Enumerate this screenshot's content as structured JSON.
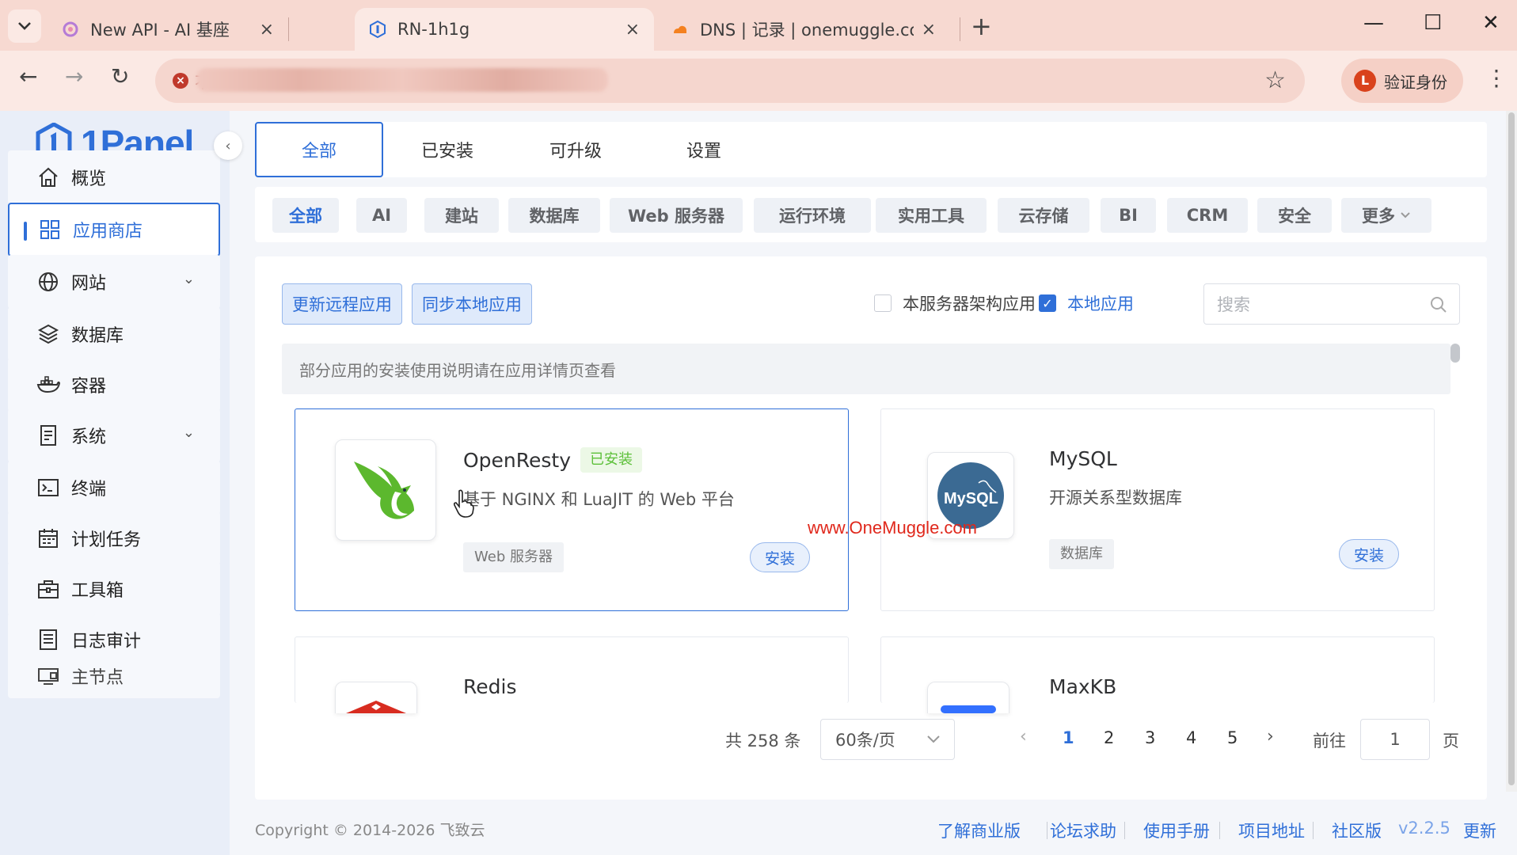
{
  "browser": {
    "tabs": [
      {
        "title": "New API - AI 基座",
        "close": "×"
      },
      {
        "title": "RN-1h1g",
        "close": "×"
      },
      {
        "title": "DNS | 记录 | onemuggle.com",
        "close": "×"
      }
    ],
    "new_tab": "+",
    "window": {
      "minimize": "—",
      "maximize": "☐",
      "close": "✕"
    },
    "nav": {
      "back": "←",
      "forward": "→",
      "reload": "↻"
    },
    "address_prefix": "不",
    "bookmark_star": "☆",
    "profile": {
      "initial": "L",
      "label": "验证身份"
    },
    "menu": "⋮"
  },
  "sidebar": {
    "logo": "1Panel",
    "collapse": "‹",
    "items": [
      {
        "label": "概览",
        "icon": "home-icon"
      },
      {
        "label": "应用商店",
        "icon": "grid-icon"
      },
      {
        "label": "网站",
        "icon": "globe-icon",
        "chevron": "⌄"
      },
      {
        "label": "数据库",
        "icon": "layers-icon"
      },
      {
        "label": "容器",
        "icon": "docker-icon"
      },
      {
        "label": "系统",
        "icon": "document-icon",
        "chevron": "⌄"
      },
      {
        "label": "终端",
        "icon": "terminal-icon"
      },
      {
        "label": "计划任务",
        "icon": "calendar-icon"
      },
      {
        "label": "工具箱",
        "icon": "toolbox-icon"
      },
      {
        "label": "日志审计",
        "icon": "log-icon"
      },
      {
        "label": "主节点",
        "icon": "node-icon"
      }
    ]
  },
  "topnav": {
    "tabs": [
      "全部",
      "已安装",
      "可升级",
      "设置"
    ]
  },
  "categories": [
    "全部",
    "AI",
    "建站",
    "数据库",
    "Web 服务器",
    "运行环境",
    "实用工具",
    "云存储",
    "BI",
    "CRM",
    "安全",
    "更多"
  ],
  "toolbar": {
    "update_remote": "更新远程应用",
    "sync_local": "同步本地应用",
    "server_arch_label": "本服务器架构应用",
    "local_app_label": "本地应用",
    "search_placeholder": "搜索"
  },
  "notice": "部分应用的安装使用说明请在应用详情页查看",
  "apps": [
    {
      "name": "OpenResty",
      "badge": "已安装",
      "desc": "基于 NGINX 和 LuaJIT 的 Web 平台",
      "tag": "Web 服务器",
      "action": "安装"
    },
    {
      "name": "MySQL",
      "desc": "开源关系型数据库",
      "tag": "数据库",
      "action": "安装",
      "logo_text": "MySQL"
    },
    {
      "name": "Redis"
    },
    {
      "name": "MaxKB"
    }
  ],
  "watermark": "www.OneMuggle.com",
  "pagination": {
    "total": "共 258 条",
    "page_size": "60条/页",
    "prev": "‹",
    "next": "›",
    "pages": [
      "1",
      "2",
      "3",
      "4",
      "5"
    ],
    "goto_label": "前往",
    "goto_value": "1",
    "goto_suffix": "页"
  },
  "footer": {
    "copyright": "Copyright © 2014-2026 飞致云",
    "links": [
      "了解商业版",
      "论坛求助",
      "使用手册",
      "项目地址",
      "社区版"
    ],
    "version": "v2.2.5",
    "update": "更新"
  },
  "colors": {
    "primary": "#2f6fd8",
    "success": "#5dc03a",
    "tabbar": "#f7d9d1",
    "watermark": "#e0281c"
  }
}
